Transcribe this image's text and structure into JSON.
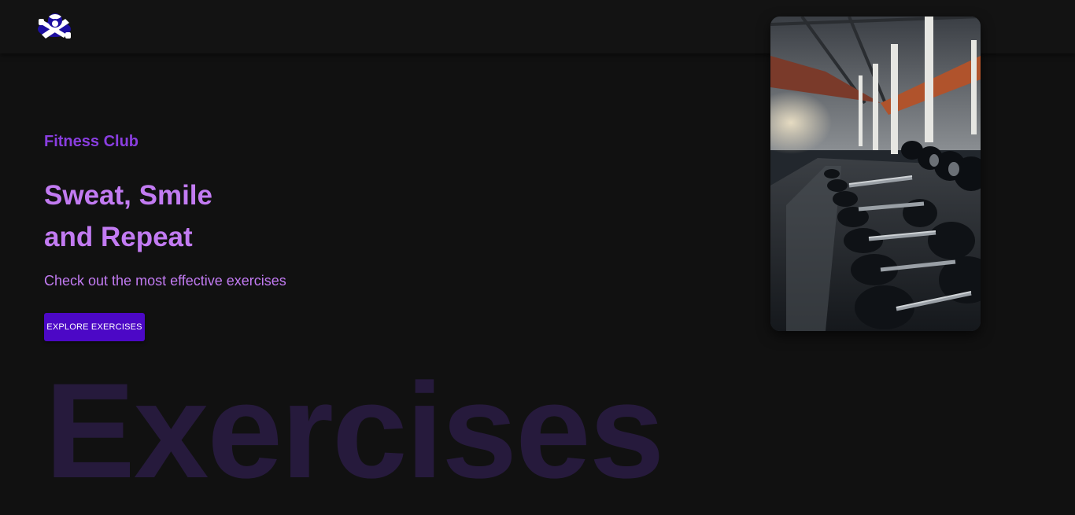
{
  "header": {
    "logo_icon": "gym-logo-icon"
  },
  "hero": {
    "label": "Fitness Club",
    "title_line1": "Sweat, Smile",
    "title_line2": "and Repeat",
    "subtitle": "Check out the most effective exercises",
    "button_label": "EXPLORE EXERCISES",
    "image_alt": "Row of dumbbells on a rack in a gym"
  },
  "background_word": "Exercises",
  "colors": {
    "page_bg": "#111111",
    "accent_purple": "#8a3ee0",
    "title_purple": "#c27bf2",
    "button_bg": "#4c08c6",
    "bg_word": "#261a3c"
  }
}
